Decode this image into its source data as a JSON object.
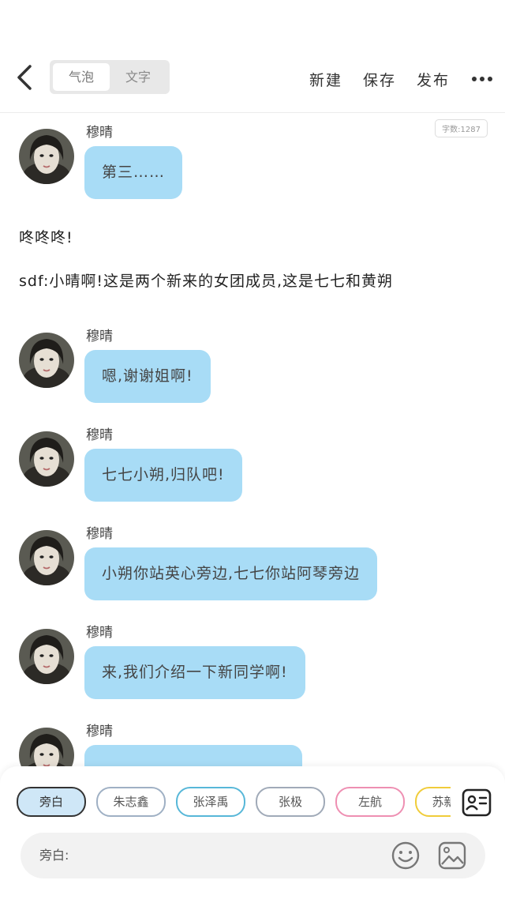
{
  "header": {
    "tabs": [
      {
        "label": "气泡",
        "active": true
      },
      {
        "label": "文字",
        "active": false
      }
    ],
    "actions": {
      "new": "新建",
      "save": "保存",
      "publish": "发布"
    }
  },
  "word_count": "字数:1287",
  "messages": [
    {
      "sender": "穆晴",
      "text": "第三……"
    },
    {
      "sender": "穆晴",
      "text": "嗯,谢谢姐啊!"
    },
    {
      "sender": "穆晴",
      "text": "七七小朔,归队吧!"
    },
    {
      "sender": "穆晴",
      "text": "小朔你站英心旁边,七七你站阿琴旁边"
    },
    {
      "sender": "穆晴",
      "text": "来,我们介绍一下新同学啊!"
    },
    {
      "sender": "穆晴",
      "text": ""
    }
  ],
  "narration": [
    "咚咚咚!",
    "sdf:小晴啊!这是两个新来的女团成员,这是七七和黄朔"
  ],
  "roles": [
    "旁白",
    "朱志鑫",
    "张泽禹",
    "张极",
    "左航",
    "苏新皓"
  ],
  "input": {
    "label": "旁白:",
    "value": ""
  },
  "colors": {
    "bubble": "#a8dcf6",
    "role_active": "#cfe7f7"
  }
}
